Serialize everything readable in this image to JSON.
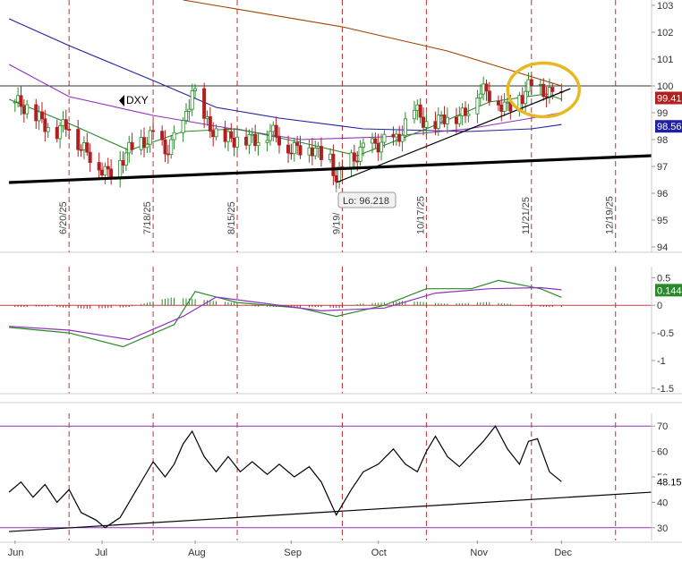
{
  "chart_data": [
    {
      "type": "candlestick",
      "panel": "price",
      "symbol": "DXY",
      "ylim": [
        93.8,
        103.2
      ],
      "y_ticks": [
        "103",
        "102",
        "101",
        "100",
        "99",
        "98",
        "97",
        "96",
        "95",
        "94"
      ],
      "last_price": "99.41",
      "last_ma": "98.56",
      "low_label": "Lo: 96.218",
      "date_markers": [
        "6/20/25",
        "7/18/25",
        "8/15/25",
        "9/19/",
        "10/17/25",
        "11/21/25",
        "12/19/25"
      ],
      "price_path": [
        [
          "2025-06-02",
          99.4
        ],
        [
          "2025-06-05",
          99.1
        ],
        [
          "2025-06-10",
          98.9
        ],
        [
          "2025-06-16",
          98.2
        ],
        [
          "2025-06-20",
          98.6
        ],
        [
          "2025-06-24",
          97.8
        ],
        [
          "2025-06-30",
          96.9
        ],
        [
          "2025-07-03",
          96.8
        ],
        [
          "2025-07-08",
          97.3
        ],
        [
          "2025-07-14",
          97.9
        ],
        [
          "2025-07-18",
          98.3
        ],
        [
          "2025-07-22",
          97.4
        ],
        [
          "2025-07-28",
          98.6
        ],
        [
          "2025-07-31",
          99.9
        ],
        [
          "2025-08-04",
          98.6
        ],
        [
          "2025-08-08",
          98.3
        ],
        [
          "2025-08-14",
          97.9
        ],
        [
          "2025-08-20",
          98.1
        ],
        [
          "2025-08-26",
          98.2
        ],
        [
          "2025-09-01",
          97.8
        ],
        [
          "2025-09-08",
          97.6
        ],
        [
          "2025-09-15",
          97.4
        ],
        [
          "2025-09-17",
          96.5
        ],
        [
          "2025-09-22",
          97.2
        ],
        [
          "2025-09-26",
          97.8
        ],
        [
          "2025-10-01",
          97.7
        ],
        [
          "2025-10-07",
          98.1
        ],
        [
          "2025-10-13",
          99.0
        ],
        [
          "2025-10-17",
          98.6
        ],
        [
          "2025-10-22",
          98.8
        ],
        [
          "2025-10-28",
          98.8
        ],
        [
          "2025-11-03",
          99.8
        ],
        [
          "2025-11-07",
          99.6
        ],
        [
          "2025-11-13",
          99.3
        ],
        [
          "2025-11-18",
          99.5
        ],
        [
          "2025-11-21",
          100.1
        ],
        [
          "2025-11-25",
          99.9
        ],
        [
          "2025-11-28",
          99.6
        ],
        [
          "2025-12-01",
          99.41
        ]
      ],
      "moving_averages": [
        {
          "color": "#a04000",
          "points": [
            [
              "2025-07-28",
              103.2
            ],
            [
              "2025-09-19",
              102.2
            ],
            [
              "2025-10-24",
              101.3
            ],
            [
              "2025-12-01",
              100.0
            ]
          ]
        },
        {
          "color": "#2020a0",
          "points": [
            [
              "2025-05-31",
              102.5
            ],
            [
              "2025-06-20",
              101.5
            ],
            [
              "2025-07-18",
              100.2
            ],
            [
              "2025-08-08",
              99.2
            ],
            [
              "2025-08-29",
              98.8
            ],
            [
              "2025-09-26",
              98.4
            ],
            [
              "2025-10-31",
              98.3
            ],
            [
              "2025-11-21",
              98.4
            ],
            [
              "2025-12-01",
              98.56
            ]
          ]
        },
        {
          "color": "#9030c0",
          "points": [
            [
              "2025-05-31",
              100.8
            ],
            [
              "2025-06-20",
              99.6
            ],
            [
              "2025-07-18",
              98.9
            ],
            [
              "2025-08-08",
              98.5
            ],
            [
              "2025-09-05",
              98.0
            ],
            [
              "2025-10-03",
              98.1
            ],
            [
              "2025-10-31",
              98.4
            ],
            [
              "2025-11-21",
              98.8
            ],
            [
              "2025-12-01",
              99.0
            ]
          ]
        },
        {
          "color": "#2a8a2a",
          "points": [
            [
              "2025-05-31",
              99.5
            ],
            [
              "2025-06-20",
              98.6
            ],
            [
              "2025-07-10",
              97.6
            ],
            [
              "2025-07-28",
              98.3
            ],
            [
              "2025-08-15",
              98.4
            ],
            [
              "2025-09-05",
              97.9
            ],
            [
              "2025-09-24",
              97.4
            ],
            [
              "2025-10-17",
              98.4
            ],
            [
              "2025-11-07",
              99.4
            ],
            [
              "2025-11-26",
              99.7
            ],
            [
              "2025-12-01",
              99.5
            ]
          ]
        }
      ],
      "horizontal_line": 100.0,
      "trendlines": [
        {
          "start": [
            "2025-05-31",
            96.4
          ],
          "end": [
            "2025-12-31",
            97.4
          ],
          "style": "thick"
        },
        {
          "start": [
            "2025-09-17",
            96.4
          ],
          "end": [
            "2025-12-04",
            99.9
          ],
          "style": "thin"
        }
      ],
      "highlight": {
        "center": [
          "2025-11-25",
          99.85
        ],
        "shape": "ellipse",
        "color": "#e8b820"
      }
    },
    {
      "type": "line",
      "panel": "macd",
      "ylim": [
        -1.6,
        0.7
      ],
      "y_ticks": [
        "0.5",
        "0",
        "-0.5",
        "-1",
        "-1.5"
      ],
      "last_value": "0.144",
      "series": [
        {
          "color": "#2a8a2a",
          "points": [
            [
              "2025-05-31",
              -0.4
            ],
            [
              "2025-06-20",
              -0.5
            ],
            [
              "2025-07-08",
              -0.75
            ],
            [
              "2025-07-25",
              -0.35
            ],
            [
              "2025-08-01",
              0.25
            ],
            [
              "2025-08-15",
              0.05
            ],
            [
              "2025-09-05",
              -0.05
            ],
            [
              "2025-09-17",
              -0.2
            ],
            [
              "2025-10-03",
              0.0
            ],
            [
              "2025-10-17",
              0.3
            ],
            [
              "2025-11-01",
              0.3
            ],
            [
              "2025-11-10",
              0.45
            ],
            [
              "2025-11-24",
              0.3
            ],
            [
              "2025-12-01",
              0.144
            ]
          ]
        },
        {
          "color": "#9030c0",
          "points": [
            [
              "2025-05-31",
              -0.38
            ],
            [
              "2025-06-20",
              -0.45
            ],
            [
              "2025-07-10",
              -0.62
            ],
            [
              "2025-07-28",
              -0.2
            ],
            [
              "2025-08-08",
              0.15
            ],
            [
              "2025-08-22",
              0.05
            ],
            [
              "2025-09-12",
              -0.1
            ],
            [
              "2025-10-03",
              -0.05
            ],
            [
              "2025-10-20",
              0.22
            ],
            [
              "2025-11-07",
              0.3
            ],
            [
              "2025-11-24",
              0.32
            ],
            [
              "2025-12-01",
              0.28
            ]
          ]
        }
      ],
      "histogram": [
        [
          "2025-06-05",
          -0.03
        ],
        [
          "2025-06-12",
          -0.02
        ],
        [
          "2025-06-19",
          -0.04
        ],
        [
          "2025-06-26",
          -0.06
        ],
        [
          "2025-07-03",
          -0.05
        ],
        [
          "2025-07-10",
          -0.03
        ],
        [
          "2025-07-17",
          0.06
        ],
        [
          "2025-07-24",
          0.14
        ],
        [
          "2025-07-31",
          0.12
        ],
        [
          "2025-08-07",
          0.08
        ],
        [
          "2025-08-14",
          0.05
        ],
        [
          "2025-08-21",
          -0.02
        ],
        [
          "2025-08-28",
          -0.03
        ],
        [
          "2025-09-04",
          -0.04
        ],
        [
          "2025-09-11",
          -0.03
        ],
        [
          "2025-09-18",
          -0.05
        ],
        [
          "2025-09-25",
          0.03
        ],
        [
          "2025-10-02",
          0.05
        ],
        [
          "2025-10-09",
          0.08
        ],
        [
          "2025-10-16",
          0.06
        ],
        [
          "2025-10-23",
          0.03
        ],
        [
          "2025-10-30",
          0.04
        ],
        [
          "2025-11-06",
          0.06
        ],
        [
          "2025-11-13",
          0.03
        ],
        [
          "2025-11-20",
          -0.02
        ],
        [
          "2025-11-27",
          -0.03
        ]
      ]
    },
    {
      "type": "line",
      "panel": "rsi",
      "ylim": [
        25,
        75
      ],
      "y_ticks": [
        "70",
        "60",
        "50",
        "40",
        "30"
      ],
      "reference_levels": [
        70,
        30
      ],
      "last_value": "48.15",
      "series": [
        {
          "color": "#000000",
          "points": [
            [
              "2025-05-31",
              44
            ],
            [
              "2025-06-04",
              48
            ],
            [
              "2025-06-08",
              42
            ],
            [
              "2025-06-12",
              47
            ],
            [
              "2025-06-16",
              40
            ],
            [
              "2025-06-20",
              45
            ],
            [
              "2025-06-24",
              36
            ],
            [
              "2025-06-29",
              33
            ],
            [
              "2025-07-02",
              30
            ],
            [
              "2025-07-07",
              34
            ],
            [
              "2025-07-11",
              42
            ],
            [
              "2025-07-15",
              50
            ],
            [
              "2025-07-18",
              56
            ],
            [
              "2025-07-22",
              50
            ],
            [
              "2025-07-25",
              55
            ],
            [
              "2025-07-28",
              63
            ],
            [
              "2025-07-31",
              68
            ],
            [
              "2025-08-04",
              58
            ],
            [
              "2025-08-08",
              52
            ],
            [
              "2025-08-12",
              58
            ],
            [
              "2025-08-16",
              52
            ],
            [
              "2025-08-20",
              56
            ],
            [
              "2025-08-25",
              51
            ],
            [
              "2025-08-29",
              55
            ],
            [
              "2025-09-03",
              50
            ],
            [
              "2025-09-08",
              54
            ],
            [
              "2025-09-12",
              48
            ],
            [
              "2025-09-17",
              35
            ],
            [
              "2025-09-22",
              45
            ],
            [
              "2025-09-26",
              52
            ],
            [
              "2025-10-01",
              55
            ],
            [
              "2025-10-06",
              61
            ],
            [
              "2025-10-10",
              55
            ],
            [
              "2025-10-14",
              52
            ],
            [
              "2025-10-17",
              60
            ],
            [
              "2025-10-20",
              66
            ],
            [
              "2025-10-24",
              58
            ],
            [
              "2025-10-28",
              54
            ],
            [
              "2025-11-01",
              59
            ],
            [
              "2025-11-05",
              64
            ],
            [
              "2025-11-09",
              70
            ],
            [
              "2025-11-13",
              61
            ],
            [
              "2025-11-17",
              55
            ],
            [
              "2025-11-20",
              64
            ],
            [
              "2025-11-23",
              65
            ],
            [
              "2025-11-27",
              52
            ],
            [
              "2025-12-01",
              48.15
            ]
          ]
        }
      ],
      "trendline": {
        "start": [
          "2025-05-31",
          28.5
        ],
        "end": [
          "2025-12-31",
          44
        ]
      }
    }
  ],
  "x_axis": {
    "labels": [
      {
        "label": "Jun",
        "date": "2025-06-02"
      },
      {
        "label": "Jul",
        "date": "2025-07-01"
      },
      {
        "label": "Aug",
        "date": "2025-08-01"
      },
      {
        "label": "Sep",
        "date": "2025-09-02"
      },
      {
        "label": "Oct",
        "date": "2025-10-01"
      },
      {
        "label": "Nov",
        "date": "2025-11-03"
      },
      {
        "label": "Dec",
        "date": "2025-12-01"
      }
    ]
  },
  "colors": {
    "up": "#2a8a2a",
    "down": "#b02020",
    "marker_line": "#c03030",
    "last_price_bg": "#b02020",
    "last_ma_bg": "#2020a0",
    "highlight": "#e8b820"
  }
}
